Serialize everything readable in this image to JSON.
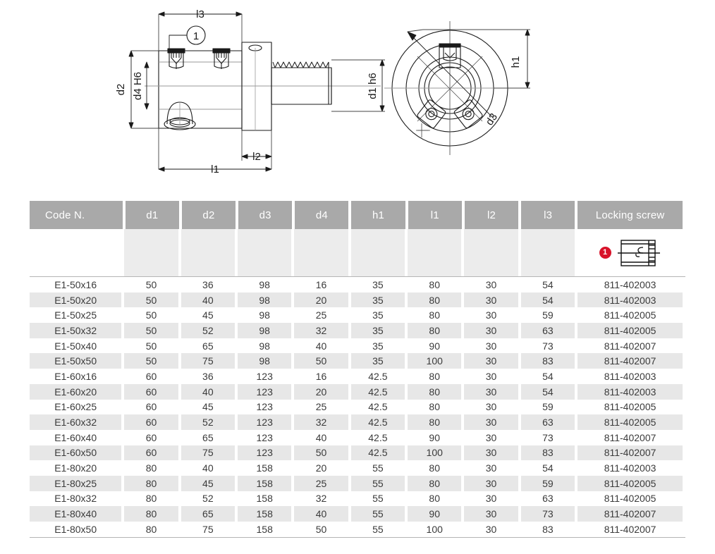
{
  "drawing": {
    "labels": {
      "l3": "l3",
      "l1": "l1",
      "l2": "l2",
      "d2": "d2",
      "d4": "d4 H6",
      "d1": "d1 h6",
      "d3": "d3",
      "h1": "h1",
      "callout_1": "1"
    }
  },
  "table": {
    "headers": [
      "Code N.",
      "d1",
      "d2",
      "d3",
      "d4",
      "h1",
      "l1",
      "l2",
      "l3",
      "Locking screw"
    ],
    "locking_screw_badge": "1",
    "columns": [
      {
        "key": "code",
        "width": 140,
        "align": "center"
      },
      {
        "key": "d1",
        "width": 82,
        "align": "center"
      },
      {
        "key": "d2",
        "width": 82,
        "align": "center"
      },
      {
        "key": "d3",
        "width": 82,
        "align": "center"
      },
      {
        "key": "d4",
        "width": 82,
        "align": "center"
      },
      {
        "key": "h1",
        "width": 82,
        "align": "center"
      },
      {
        "key": "l1",
        "width": 82,
        "align": "center"
      },
      {
        "key": "l2",
        "width": 82,
        "align": "center"
      },
      {
        "key": "l3",
        "width": 82,
        "align": "center"
      },
      {
        "key": "screw",
        "width": 160,
        "align": "center"
      }
    ],
    "rows": [
      [
        "E1-50x16",
        "50",
        "36",
        "98",
        "16",
        "35",
        "80",
        "30",
        "54",
        "811-402003"
      ],
      [
        "E1-50x20",
        "50",
        "40",
        "98",
        "20",
        "35",
        "80",
        "30",
        "54",
        "811-402003"
      ],
      [
        "E1-50x25",
        "50",
        "45",
        "98",
        "25",
        "35",
        "80",
        "30",
        "59",
        "811-402005"
      ],
      [
        "E1-50x32",
        "50",
        "52",
        "98",
        "32",
        "35",
        "80",
        "30",
        "63",
        "811-402005"
      ],
      [
        "E1-50x40",
        "50",
        "65",
        "98",
        "40",
        "35",
        "90",
        "30",
        "73",
        "811-402007"
      ],
      [
        "E1-50x50",
        "50",
        "75",
        "98",
        "50",
        "35",
        "100",
        "30",
        "83",
        "811-402007"
      ],
      [
        "E1-60x16",
        "60",
        "36",
        "123",
        "16",
        "42.5",
        "80",
        "30",
        "54",
        "811-402003"
      ],
      [
        "E1-60x20",
        "60",
        "40",
        "123",
        "20",
        "42.5",
        "80",
        "30",
        "54",
        "811-402003"
      ],
      [
        "E1-60x25",
        "60",
        "45",
        "123",
        "25",
        "42.5",
        "80",
        "30",
        "59",
        "811-402005"
      ],
      [
        "E1-60x32",
        "60",
        "52",
        "123",
        "32",
        "42.5",
        "80",
        "30",
        "63",
        "811-402005"
      ],
      [
        "E1-60x40",
        "60",
        "65",
        "123",
        "40",
        "42.5",
        "90",
        "30",
        "73",
        "811-402007"
      ],
      [
        "E1-60x50",
        "60",
        "75",
        "123",
        "50",
        "42.5",
        "100",
        "30",
        "83",
        "811-402007"
      ],
      [
        "E1-80x20",
        "80",
        "40",
        "158",
        "20",
        "55",
        "80",
        "30",
        "54",
        "811-402003"
      ],
      [
        "E1-80x25",
        "80",
        "45",
        "158",
        "25",
        "55",
        "80",
        "30",
        "59",
        "811-402005"
      ],
      [
        "E1-80x32",
        "80",
        "52",
        "158",
        "32",
        "55",
        "80",
        "30",
        "63",
        "811-402005"
      ],
      [
        "E1-80x40",
        "80",
        "65",
        "158",
        "40",
        "55",
        "90",
        "30",
        "73",
        "811-402007"
      ],
      [
        "E1-80x50",
        "80",
        "75",
        "158",
        "50",
        "55",
        "100",
        "30",
        "83",
        "811-402007"
      ]
    ]
  },
  "colors": {
    "header_bg": "#a9a9a9",
    "header_text": "#ffffff",
    "row_stripe": "#e7e7e7",
    "badge_red": "#d8132a",
    "rule": "#b5b5b5",
    "text": "#3b3b3b"
  }
}
